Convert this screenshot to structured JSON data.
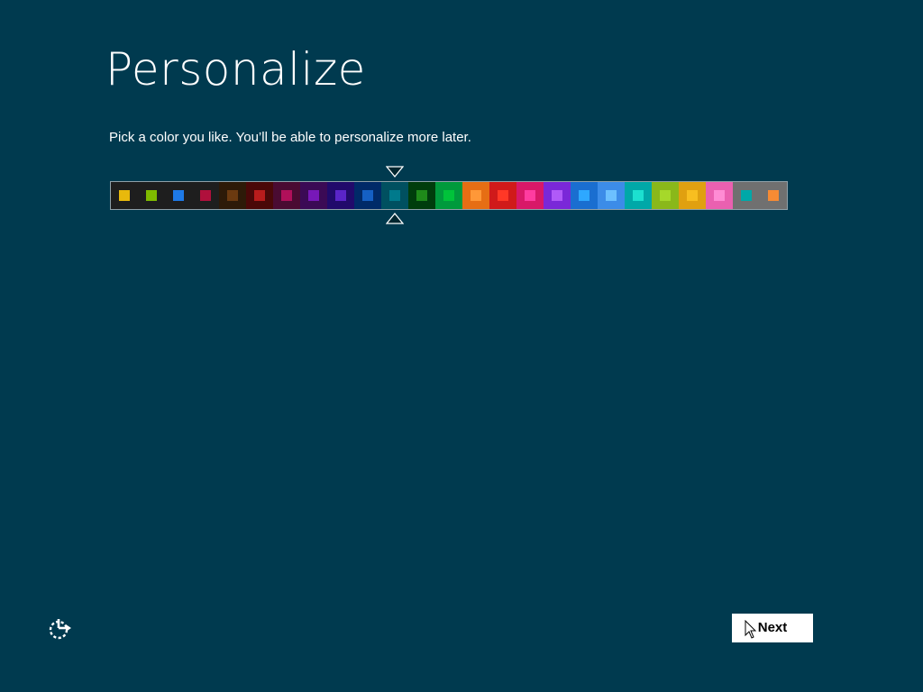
{
  "page": {
    "title": "Personalize",
    "instruction": "Pick a color you like. You’ll be able to personalize more later."
  },
  "colors": {
    "page_background": "#003a4f",
    "selected_index": 10,
    "swatches": [
      {
        "bg": "#1e1e1e",
        "chip": "#e8b90c"
      },
      {
        "bg": "#1e1e1e",
        "chip": "#7fba00"
      },
      {
        "bg": "#1e1e1e",
        "chip": "#1e79e6"
      },
      {
        "bg": "#1e1e1e",
        "chip": "#b0103c"
      },
      {
        "bg": "#2d1a08",
        "chip": "#6b3a10"
      },
      {
        "bg": "#4a0808",
        "chip": "#b81c1c"
      },
      {
        "bg": "#4a0b32",
        "chip": "#b0105a"
      },
      {
        "bg": "#3b0a55",
        "chip": "#7718b8"
      },
      {
        "bg": "#210a6b",
        "chip": "#5a25c8"
      },
      {
        "bg": "#002a68",
        "chip": "#1560c4"
      },
      {
        "bg": "#005060",
        "chip": "#007a8c"
      },
      {
        "bg": "#003d0c",
        "chip": "#1f8a1a"
      },
      {
        "bg": "#009a3c",
        "chip": "#00c33a"
      },
      {
        "bg": "#e66e14",
        "chip": "#ff9838"
      },
      {
        "bg": "#d01a1a",
        "chip": "#ff3826"
      },
      {
        "bg": "#d81868",
        "chip": "#ff3ca0"
      },
      {
        "bg": "#7a28d8",
        "chip": "#b05af8"
      },
      {
        "bg": "#1a6ed0",
        "chip": "#2ea8ff"
      },
      {
        "bg": "#3c8ce8",
        "chip": "#6cc0ff"
      },
      {
        "bg": "#00a8a8",
        "chip": "#1ce0d0"
      },
      {
        "bg": "#8ab81a",
        "chip": "#a6d82a"
      },
      {
        "bg": "#e0a010",
        "chip": "#f8be20"
      },
      {
        "bg": "#ea60b0",
        "chip": "#ff8cd4"
      },
      {
        "bg": "#707070",
        "chip": "#00a8a8"
      },
      {
        "bg": "#707070",
        "chip": "#f68b34"
      }
    ]
  },
  "footer": {
    "ease_of_access_icon": "ease-of-access-icon",
    "next_label": "Next"
  }
}
